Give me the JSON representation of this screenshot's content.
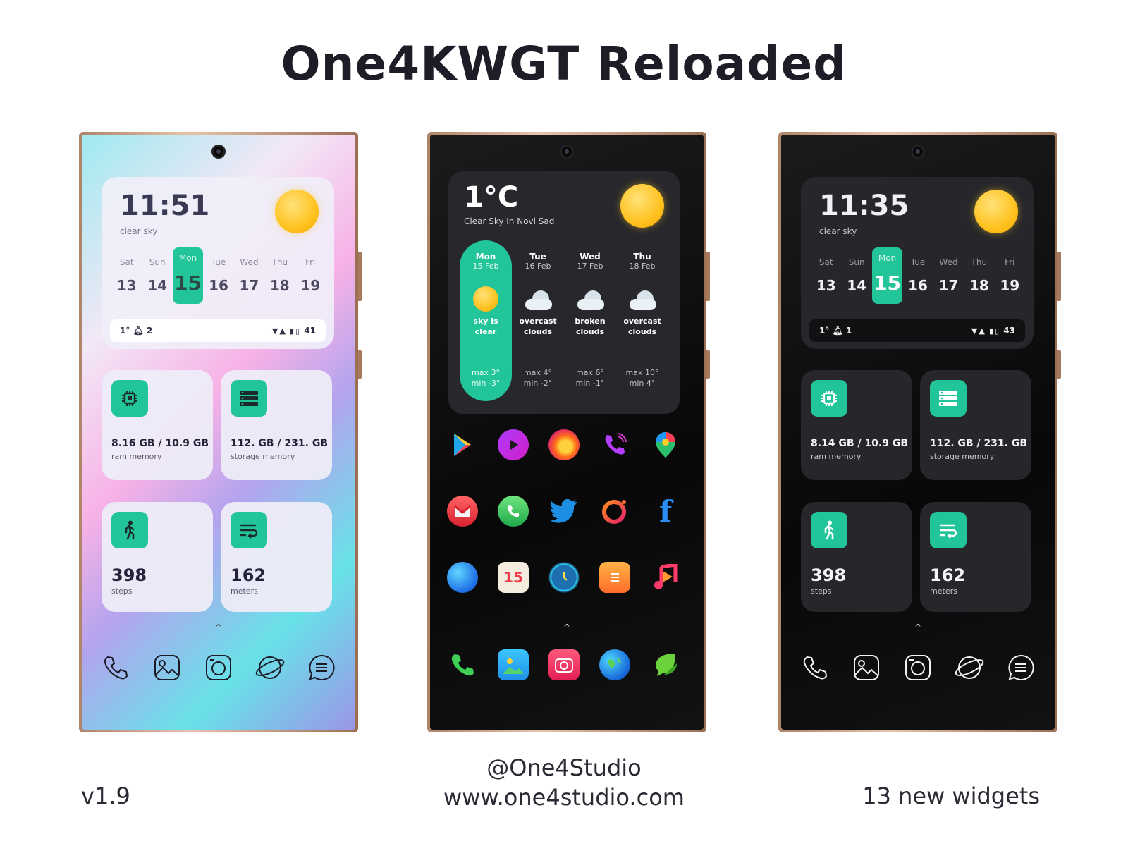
{
  "header": {
    "title": "One4KWGT Reloaded"
  },
  "footer": {
    "version": "v1.9",
    "handle": "@One4Studio",
    "website": "www.one4studio.com",
    "widgets": "13 new widgets"
  },
  "colors": {
    "accent": "#22c49a",
    "sun": "#ffc21f"
  },
  "phone_light": {
    "clock": {
      "time": "11:51",
      "condition": "clear sky"
    },
    "days": [
      {
        "name": "Sat",
        "date": "13"
      },
      {
        "name": "Sun",
        "date": "14"
      },
      {
        "name": "Mon",
        "date": "15"
      },
      {
        "name": "Tue",
        "date": "16"
      },
      {
        "name": "Wed",
        "date": "17"
      },
      {
        "name": "Thu",
        "date": "18"
      },
      {
        "name": "Fri",
        "date": "19"
      }
    ],
    "status": {
      "temp": "1°",
      "notifications": "2",
      "battery": "41"
    },
    "ram": {
      "value": "8.16 GB / 10.9 GB",
      "label": "ram memory"
    },
    "storage": {
      "value": "112. GB / 231. GB",
      "label": "storage memory"
    },
    "steps": {
      "value": "398",
      "label": "steps"
    },
    "distance": {
      "value": "162",
      "label": "meters"
    }
  },
  "phone_weather": {
    "temp": "1°C",
    "location": "Clear Sky In Novi Sad",
    "forecast": [
      {
        "day": "Mon",
        "date": "15 Feb",
        "icon": "sun-icon",
        "desc1": "sky is",
        "desc2": "clear",
        "max": "max 3°",
        "min": "min -3°"
      },
      {
        "day": "Tue",
        "date": "16 Feb",
        "icon": "cloud-icon",
        "desc1": "overcast",
        "desc2": "clouds",
        "max": "max 4°",
        "min": "min -2°"
      },
      {
        "day": "Wed",
        "date": "17 Feb",
        "icon": "cloud-icon",
        "desc1": "broken",
        "desc2": "clouds",
        "max": "max 6°",
        "min": "min -1°"
      },
      {
        "day": "Thu",
        "date": "18 Feb",
        "icon": "cloud-icon",
        "desc1": "overcast",
        "desc2": "clouds",
        "max": "max 10°",
        "min": "min 4°"
      }
    ],
    "apps": {
      "row1": [
        "play-store-icon",
        "video-player-icon",
        "firefox-icon",
        "phone-call-icon",
        "maps-icon"
      ],
      "row2": [
        "gmail-icon",
        "whatsapp-icon",
        "twitter-icon",
        "opera-icon",
        "facebook-icon"
      ],
      "row3": [
        "browser-icon",
        "calendar-icon",
        "clock-icon",
        "notes-icon",
        "music-icon"
      ],
      "dock": [
        "phone-icon",
        "gallery-icon",
        "camera-icon",
        "globe-icon",
        "messages-icon"
      ]
    },
    "calendar_date": "15"
  },
  "phone_dark": {
    "clock": {
      "time": "11:35",
      "condition": "clear sky"
    },
    "days": [
      {
        "name": "Sat",
        "date": "13"
      },
      {
        "name": "Sun",
        "date": "14"
      },
      {
        "name": "Mon",
        "date": "15"
      },
      {
        "name": "Tue",
        "date": "16"
      },
      {
        "name": "Wed",
        "date": "17"
      },
      {
        "name": "Thu",
        "date": "18"
      },
      {
        "name": "Fri",
        "date": "19"
      }
    ],
    "status": {
      "temp": "1°",
      "notifications": "1",
      "battery": "43"
    },
    "ram": {
      "value": "8.14 GB / 10.9 GB",
      "label": "ram memory"
    },
    "storage": {
      "value": "112. GB / 231. GB",
      "label": "storage memory"
    },
    "steps": {
      "value": "398",
      "label": "steps"
    },
    "distance": {
      "value": "162",
      "label": "meters"
    }
  }
}
